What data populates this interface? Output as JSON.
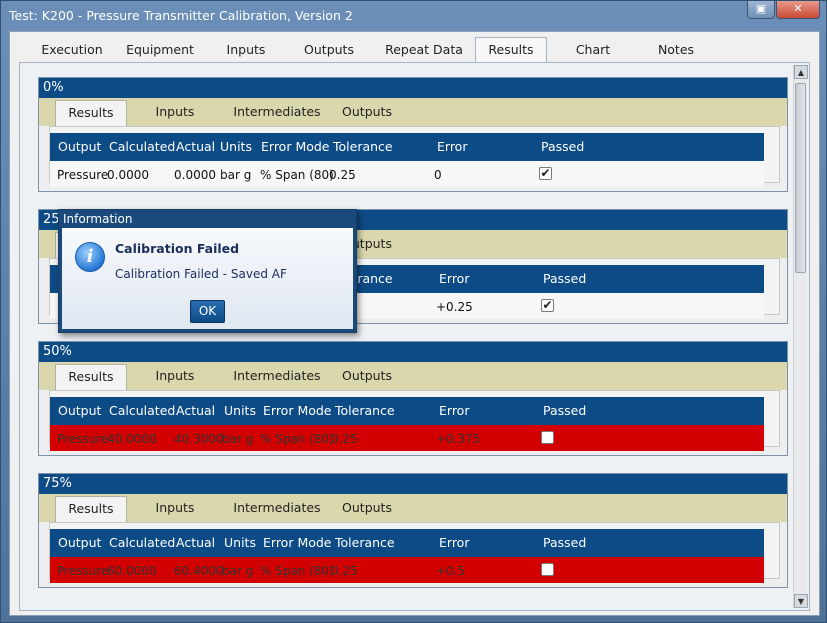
{
  "window": {
    "title": "Test: K200 - Pressure Transmitter Calibration, Version 2",
    "maximize_glyph": "▣",
    "close_glyph": "✕"
  },
  "main_tabs": [
    "Execution",
    "Equipment",
    "Inputs",
    "Outputs",
    "Repeat Data",
    "Results",
    "Chart",
    "Notes"
  ],
  "active_main_tab": "Results",
  "sub_tabs": [
    "Results",
    "Inputs",
    "Intermediates",
    "Outputs"
  ],
  "columns": [
    "Output",
    "Calculated",
    "Actual",
    "Units",
    "Error Mode",
    "Tolerance",
    "Error",
    "Passed"
  ],
  "panels": [
    {
      "title": "0%",
      "row": {
        "output": "Pressure",
        "calculated": "0.0000",
        "actual": "0.0000",
        "units": "bar g",
        "error_mode": "% Span (80)",
        "tolerance": "0.25",
        "error": "0",
        "passed": true
      }
    },
    {
      "title": "25%",
      "row": {
        "output": "",
        "calculated": "",
        "actual": "",
        "units": "",
        "error_mode": "",
        "tolerance": "",
        "error": "+0.25",
        "passed": true
      }
    },
    {
      "title": "50%",
      "row": {
        "output": "Pressure",
        "calculated": "40.0000",
        "actual": "40.3000",
        "units": "bar g",
        "error_mode": "% Span (80)",
        "tolerance": "0.25",
        "error": "+0.375",
        "passed": false
      }
    },
    {
      "title": "75%",
      "row": {
        "output": "Pressure",
        "calculated": "60.0000",
        "actual": "60.4000",
        "units": "bar g",
        "error_mode": "% Span (80)",
        "tolerance": "0.25",
        "error": "+0.5",
        "passed": false
      }
    }
  ],
  "dialog": {
    "title": "Information",
    "heading": "Calibration Failed",
    "message": "Calibration Failed - Saved AF",
    "ok_label": "OK",
    "icon": "info-icon"
  },
  "scrollbar": {
    "up_glyph": "▲",
    "down_glyph": "▼"
  },
  "colors": {
    "header_blue": "#0d4b86",
    "fail_red": "#d20000",
    "subtab_bg": "#d9d7ab"
  }
}
